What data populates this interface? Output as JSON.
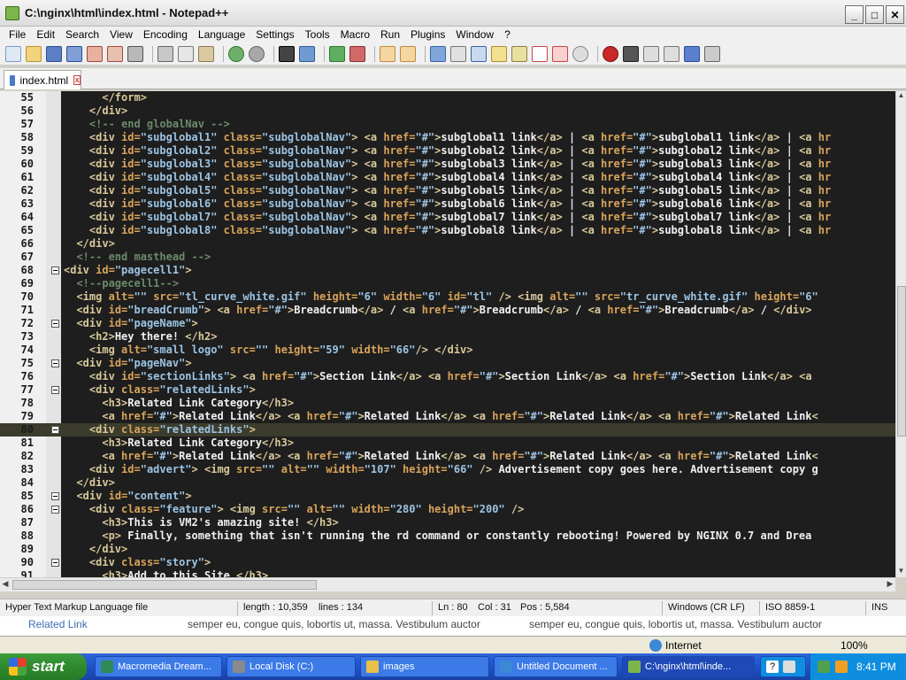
{
  "window": {
    "title": "C:\\nginx\\html\\index.html - Notepad++",
    "min_label": "_",
    "max_label": "□",
    "close_label": "✕"
  },
  "menu": [
    "File",
    "Edit",
    "Search",
    "View",
    "Encoding",
    "Language",
    "Settings",
    "Tools",
    "Macro",
    "Run",
    "Plugins",
    "Window",
    "?"
  ],
  "tab": {
    "label": "index.html"
  },
  "editor": {
    "current_line": 80,
    "lines": [
      {
        "n": "55",
        "fold": false,
        "html": "      <span class=\"tag\">&lt;/form&gt;</span>"
      },
      {
        "n": "56",
        "fold": false,
        "html": "    <span class=\"tag\">&lt;/div&gt;</span>"
      },
      {
        "n": "57",
        "fold": false,
        "html": "    <span class=\"cmt\">&lt;!-- end globalNav --&gt;</span>"
      },
      {
        "n": "58",
        "fold": false,
        "html": "    <span class=\"tag\">&lt;div</span> <span class=\"attr\">id=</span><span class=\"val\">\"subglobal1\"</span> <span class=\"attr\">class=</span><span class=\"val\">\"subglobalNav\"</span><span class=\"tag\">&gt;</span> <span class=\"tag\">&lt;a</span> <span class=\"attr\">href=</span><span class=\"val\">\"#\"</span><span class=\"tag\">&gt;</span><span class=\"txt\">subglobal1 link</span><span class=\"tag\">&lt;/a&gt;</span> | <span class=\"tag\">&lt;a</span> <span class=\"attr\">href=</span><span class=\"val\">\"#\"</span><span class=\"tag\">&gt;</span><span class=\"txt\">subglobal1 link</span><span class=\"tag\">&lt;/a&gt;</span> | <span class=\"tag\">&lt;a</span> <span class=\"attr\">hr</span>"
      },
      {
        "n": "59",
        "fold": false,
        "html": "    <span class=\"tag\">&lt;div</span> <span class=\"attr\">id=</span><span class=\"val\">\"subglobal2\"</span> <span class=\"attr\">class=</span><span class=\"val\">\"subglobalNav\"</span><span class=\"tag\">&gt;</span> <span class=\"tag\">&lt;a</span> <span class=\"attr\">href=</span><span class=\"val\">\"#\"</span><span class=\"tag\">&gt;</span><span class=\"txt\">subglobal2 link</span><span class=\"tag\">&lt;/a&gt;</span> | <span class=\"tag\">&lt;a</span> <span class=\"attr\">href=</span><span class=\"val\">\"#\"</span><span class=\"tag\">&gt;</span><span class=\"txt\">subglobal2 link</span><span class=\"tag\">&lt;/a&gt;</span> | <span class=\"tag\">&lt;a</span> <span class=\"attr\">hr</span>"
      },
      {
        "n": "60",
        "fold": false,
        "html": "    <span class=\"tag\">&lt;div</span> <span class=\"attr\">id=</span><span class=\"val\">\"subglobal3\"</span> <span class=\"attr\">class=</span><span class=\"val\">\"subglobalNav\"</span><span class=\"tag\">&gt;</span> <span class=\"tag\">&lt;a</span> <span class=\"attr\">href=</span><span class=\"val\">\"#\"</span><span class=\"tag\">&gt;</span><span class=\"txt\">subglobal3 link</span><span class=\"tag\">&lt;/a&gt;</span> | <span class=\"tag\">&lt;a</span> <span class=\"attr\">href=</span><span class=\"val\">\"#\"</span><span class=\"tag\">&gt;</span><span class=\"txt\">subglobal3 link</span><span class=\"tag\">&lt;/a&gt;</span> | <span class=\"tag\">&lt;a</span> <span class=\"attr\">hr</span>"
      },
      {
        "n": "61",
        "fold": false,
        "html": "    <span class=\"tag\">&lt;div</span> <span class=\"attr\">id=</span><span class=\"val\">\"subglobal4\"</span> <span class=\"attr\">class=</span><span class=\"val\">\"subglobalNav\"</span><span class=\"tag\">&gt;</span> <span class=\"tag\">&lt;a</span> <span class=\"attr\">href=</span><span class=\"val\">\"#\"</span><span class=\"tag\">&gt;</span><span class=\"txt\">subglobal4 link</span><span class=\"tag\">&lt;/a&gt;</span> | <span class=\"tag\">&lt;a</span> <span class=\"attr\">href=</span><span class=\"val\">\"#\"</span><span class=\"tag\">&gt;</span><span class=\"txt\">subglobal4 link</span><span class=\"tag\">&lt;/a&gt;</span> | <span class=\"tag\">&lt;a</span> <span class=\"attr\">hr</span>"
      },
      {
        "n": "62",
        "fold": false,
        "html": "    <span class=\"tag\">&lt;div</span> <span class=\"attr\">id=</span><span class=\"val\">\"subglobal5\"</span> <span class=\"attr\">class=</span><span class=\"val\">\"subglobalNav\"</span><span class=\"tag\">&gt;</span> <span class=\"tag\">&lt;a</span> <span class=\"attr\">href=</span><span class=\"val\">\"#\"</span><span class=\"tag\">&gt;</span><span class=\"txt\">subglobal5 link</span><span class=\"tag\">&lt;/a&gt;</span> | <span class=\"tag\">&lt;a</span> <span class=\"attr\">href=</span><span class=\"val\">\"#\"</span><span class=\"tag\">&gt;</span><span class=\"txt\">subglobal5 link</span><span class=\"tag\">&lt;/a&gt;</span> | <span class=\"tag\">&lt;a</span> <span class=\"attr\">hr</span>"
      },
      {
        "n": "63",
        "fold": false,
        "html": "    <span class=\"tag\">&lt;div</span> <span class=\"attr\">id=</span><span class=\"val\">\"subglobal6\"</span> <span class=\"attr\">class=</span><span class=\"val\">\"subglobalNav\"</span><span class=\"tag\">&gt;</span> <span class=\"tag\">&lt;a</span> <span class=\"attr\">href=</span><span class=\"val\">\"#\"</span><span class=\"tag\">&gt;</span><span class=\"txt\">subglobal6 link</span><span class=\"tag\">&lt;/a&gt;</span> | <span class=\"tag\">&lt;a</span> <span class=\"attr\">href=</span><span class=\"val\">\"#\"</span><span class=\"tag\">&gt;</span><span class=\"txt\">subglobal6 link</span><span class=\"tag\">&lt;/a&gt;</span> | <span class=\"tag\">&lt;a</span> <span class=\"attr\">hr</span>"
      },
      {
        "n": "64",
        "fold": false,
        "html": "    <span class=\"tag\">&lt;div</span> <span class=\"attr\">id=</span><span class=\"val\">\"subglobal7\"</span> <span class=\"attr\">class=</span><span class=\"val\">\"subglobalNav\"</span><span class=\"tag\">&gt;</span> <span class=\"tag\">&lt;a</span> <span class=\"attr\">href=</span><span class=\"val\">\"#\"</span><span class=\"tag\">&gt;</span><span class=\"txt\">subglobal7 link</span><span class=\"tag\">&lt;/a&gt;</span> | <span class=\"tag\">&lt;a</span> <span class=\"attr\">href=</span><span class=\"val\">\"#\"</span><span class=\"tag\">&gt;</span><span class=\"txt\">subglobal7 link</span><span class=\"tag\">&lt;/a&gt;</span> | <span class=\"tag\">&lt;a</span> <span class=\"attr\">hr</span>"
      },
      {
        "n": "65",
        "fold": false,
        "html": "    <span class=\"tag\">&lt;div</span> <span class=\"attr\">id=</span><span class=\"val\">\"subglobal8\"</span> <span class=\"attr\">class=</span><span class=\"val\">\"subglobalNav\"</span><span class=\"tag\">&gt;</span> <span class=\"tag\">&lt;a</span> <span class=\"attr\">href=</span><span class=\"val\">\"#\"</span><span class=\"tag\">&gt;</span><span class=\"txt\">subglobal8 link</span><span class=\"tag\">&lt;/a&gt;</span> | <span class=\"tag\">&lt;a</span> <span class=\"attr\">href=</span><span class=\"val\">\"#\"</span><span class=\"tag\">&gt;</span><span class=\"txt\">subglobal8 link</span><span class=\"tag\">&lt;/a&gt;</span> | <span class=\"tag\">&lt;a</span> <span class=\"attr\">hr</span>"
      },
      {
        "n": "66",
        "fold": false,
        "html": "  <span class=\"tag\">&lt;/div&gt;</span>"
      },
      {
        "n": "67",
        "fold": false,
        "html": "  <span class=\"cmt\">&lt;!-- end masthead --&gt;</span>"
      },
      {
        "n": "68",
        "fold": true,
        "html": "<span class=\"tag\">&lt;div</span> <span class=\"attr\">id=</span><span class=\"val\">\"pagecell1\"</span><span class=\"tag\">&gt;</span>"
      },
      {
        "n": "69",
        "fold": false,
        "html": "  <span class=\"cmt\">&lt;!--pagecell1--&gt;</span>"
      },
      {
        "n": "70",
        "fold": false,
        "html": "  <span class=\"tag\">&lt;img</span> <span class=\"attr\">alt=</span><span class=\"val\">\"\"</span> <span class=\"attr\">src=</span><span class=\"val\">\"tl_curve_white.gif\"</span> <span class=\"attr\">height=</span><span class=\"val\">\"6\"</span> <span class=\"attr\">width=</span><span class=\"val\">\"6\"</span> <span class=\"attr\">id=</span><span class=\"val\">\"tl\"</span> <span class=\"tag\">/&gt;</span> <span class=\"tag\">&lt;img</span> <span class=\"attr\">alt=</span><span class=\"val\">\"\"</span> <span class=\"attr\">src=</span><span class=\"val\">\"tr_curve_white.gif\"</span> <span class=\"attr\">height=</span><span class=\"val\">\"6\"</span>"
      },
      {
        "n": "71",
        "fold": false,
        "html": "  <span class=\"tag\">&lt;div</span> <span class=\"attr\">id=</span><span class=\"val\">\"breadCrumb\"</span><span class=\"tag\">&gt;</span> <span class=\"tag\">&lt;a</span> <span class=\"attr\">href=</span><span class=\"val\">\"#\"</span><span class=\"tag\">&gt;</span><span class=\"txt\">Breadcrumb</span><span class=\"tag\">&lt;/a&gt;</span> / <span class=\"tag\">&lt;a</span> <span class=\"attr\">href=</span><span class=\"val\">\"#\"</span><span class=\"tag\">&gt;</span><span class=\"txt\">Breadcrumb</span><span class=\"tag\">&lt;/a&gt;</span> / <span class=\"tag\">&lt;a</span> <span class=\"attr\">href=</span><span class=\"val\">\"#\"</span><span class=\"tag\">&gt;</span><span class=\"txt\">Breadcrumb</span><span class=\"tag\">&lt;/a&gt;</span> / <span class=\"tag\">&lt;/div&gt;</span>"
      },
      {
        "n": "72",
        "fold": true,
        "html": "  <span class=\"tag\">&lt;div</span> <span class=\"attr\">id=</span><span class=\"val\">\"pageName\"</span><span class=\"tag\">&gt;</span>"
      },
      {
        "n": "73",
        "fold": false,
        "html": "    <span class=\"tag\">&lt;h2&gt;</span><span class=\"txt\">Hey there! </span><span class=\"tag\">&lt;/h2&gt;</span>"
      },
      {
        "n": "74",
        "fold": false,
        "html": "    <span class=\"tag\">&lt;img</span> <span class=\"attr\">alt=</span><span class=\"val\">\"small logo\"</span> <span class=\"attr\">src=</span><span class=\"val\">\"\"</span> <span class=\"attr\">height=</span><span class=\"val\">\"59\"</span> <span class=\"attr\">width=</span><span class=\"val\">\"66\"</span><span class=\"tag\">/&gt;</span> <span class=\"tag\">&lt;/div&gt;</span>"
      },
      {
        "n": "75",
        "fold": true,
        "html": "  <span class=\"tag\">&lt;div</span> <span class=\"attr\">id=</span><span class=\"val\">\"pageNav\"</span><span class=\"tag\">&gt;</span>"
      },
      {
        "n": "76",
        "fold": false,
        "html": "    <span class=\"tag\">&lt;div</span> <span class=\"attr\">id=</span><span class=\"val\">\"sectionLinks\"</span><span class=\"tag\">&gt;</span> <span class=\"tag\">&lt;a</span> <span class=\"attr\">href=</span><span class=\"val\">\"#\"</span><span class=\"tag\">&gt;</span><span class=\"txt\">Section Link</span><span class=\"tag\">&lt;/a&gt;</span> <span class=\"tag\">&lt;a</span> <span class=\"attr\">href=</span><span class=\"val\">\"#\"</span><span class=\"tag\">&gt;</span><span class=\"txt\">Section Link</span><span class=\"tag\">&lt;/a&gt;</span> <span class=\"tag\">&lt;a</span> <span class=\"attr\">href=</span><span class=\"val\">\"#\"</span><span class=\"tag\">&gt;</span><span class=\"txt\">Section Link</span><span class=\"tag\">&lt;/a&gt;</span> <span class=\"tag\">&lt;a</span>"
      },
      {
        "n": "77",
        "fold": true,
        "html": "    <span class=\"tag\">&lt;div</span> <span class=\"attr\">class=</span><span class=\"val\">\"relatedLinks\"</span><span class=\"tag\">&gt;</span>"
      },
      {
        "n": "78",
        "fold": false,
        "html": "      <span class=\"tag\">&lt;h3&gt;</span><span class=\"txt\">Related Link Category</span><span class=\"tag\">&lt;/h3&gt;</span>"
      },
      {
        "n": "79",
        "fold": false,
        "html": "      <span class=\"tag\">&lt;a</span> <span class=\"attr\">href=</span><span class=\"val\">\"#\"</span><span class=\"tag\">&gt;</span><span class=\"txt\">Related Link</span><span class=\"tag\">&lt;/a&gt;</span> <span class=\"tag\">&lt;a</span> <span class=\"attr\">href=</span><span class=\"val\">\"#\"</span><span class=\"tag\">&gt;</span><span class=\"txt\">Related Link</span><span class=\"tag\">&lt;/a&gt;</span> <span class=\"tag\">&lt;a</span> <span class=\"attr\">href=</span><span class=\"val\">\"#\"</span><span class=\"tag\">&gt;</span><span class=\"txt\">Related Link</span><span class=\"tag\">&lt;/a&gt;</span> <span class=\"tag\">&lt;a</span> <span class=\"attr\">href=</span><span class=\"val\">\"#\"</span><span class=\"tag\">&gt;</span><span class=\"txt\">Related Link</span><span class=\"tag\">&lt;</span>"
      },
      {
        "n": "80",
        "fold": true,
        "html": "    <span class=\"tag\">&lt;div</span> <span class=\"attr\">class=</span><span class=\"val\">\"relatedLinks\"</span><span class=\"tag\">&gt;</span>"
      },
      {
        "n": "81",
        "fold": false,
        "html": "      <span class=\"tag\">&lt;h3&gt;</span><span class=\"txt\">Related Link Category</span><span class=\"tag\">&lt;/h3&gt;</span>"
      },
      {
        "n": "82",
        "fold": false,
        "html": "      <span class=\"tag\">&lt;a</span> <span class=\"attr\">href=</span><span class=\"val\">\"#\"</span><span class=\"tag\">&gt;</span><span class=\"txt\">Related Link</span><span class=\"tag\">&lt;/a&gt;</span> <span class=\"tag\">&lt;a</span> <span class=\"attr\">href=</span><span class=\"val\">\"#\"</span><span class=\"tag\">&gt;</span><span class=\"txt\">Related Link</span><span class=\"tag\">&lt;/a&gt;</span> <span class=\"tag\">&lt;a</span> <span class=\"attr\">href=</span><span class=\"val\">\"#\"</span><span class=\"tag\">&gt;</span><span class=\"txt\">Related Link</span><span class=\"tag\">&lt;/a&gt;</span> <span class=\"tag\">&lt;a</span> <span class=\"attr\">href=</span><span class=\"val\">\"#\"</span><span class=\"tag\">&gt;</span><span class=\"txt\">Related Link</span><span class=\"tag\">&lt;</span>"
      },
      {
        "n": "83",
        "fold": false,
        "html": "    <span class=\"tag\">&lt;div</span> <span class=\"attr\">id=</span><span class=\"val\">\"advert\"</span><span class=\"tag\">&gt;</span> <span class=\"tag\">&lt;img</span> <span class=\"attr\">src=</span><span class=\"val\">\"\"</span> <span class=\"attr\">alt=</span><span class=\"val\">\"\"</span> <span class=\"attr\">width=</span><span class=\"val\">\"107\"</span> <span class=\"attr\">height=</span><span class=\"val\">\"66\"</span> <span class=\"tag\">/&gt;</span> <span class=\"txt\">Advertisement copy goes here. Advertisement copy g</span>"
      },
      {
        "n": "84",
        "fold": false,
        "html": "  <span class=\"tag\">&lt;/div&gt;</span>"
      },
      {
        "n": "85",
        "fold": true,
        "html": "  <span class=\"tag\">&lt;div</span> <span class=\"attr\">id=</span><span class=\"val\">\"content\"</span><span class=\"tag\">&gt;</span>"
      },
      {
        "n": "86",
        "fold": true,
        "html": "    <span class=\"tag\">&lt;div</span> <span class=\"attr\">class=</span><span class=\"val\">\"feature\"</span><span class=\"tag\">&gt;</span> <span class=\"tag\">&lt;img</span> <span class=\"attr\">src=</span><span class=\"val\">\"\"</span> <span class=\"attr\">alt=</span><span class=\"val\">\"\"</span> <span class=\"attr\">width=</span><span class=\"val\">\"280\"</span> <span class=\"attr\">height=</span><span class=\"val\">\"200\"</span> <span class=\"tag\">/&gt;</span>"
      },
      {
        "n": "87",
        "fold": false,
        "html": "      <span class=\"tag\">&lt;h3&gt;</span><span class=\"txt\">This is VM2's amazing site! </span><span class=\"tag\">&lt;/h3&gt;</span>"
      },
      {
        "n": "88",
        "fold": false,
        "html": "      <span class=\"tag\">&lt;p&gt;</span><span class=\"txt\"> Finally, something that isn't running the rd command or constantly rebooting! Powered by NGINX 0.7 and Drea</span>"
      },
      {
        "n": "89",
        "fold": false,
        "html": "    <span class=\"tag\">&lt;/div&gt;</span>"
      },
      {
        "n": "90",
        "fold": true,
        "html": "    <span class=\"tag\">&lt;div</span> <span class=\"attr\">class=</span><span class=\"val\">\"story\"</span><span class=\"tag\">&gt;</span>"
      },
      {
        "n": "91",
        "fold": false,
        "html": "      <span class=\"tag\">&lt;h3&gt;</span><span class=\"txt\">Add to this Site </span><span class=\"tag\">&lt;/h3&gt;</span>"
      }
    ]
  },
  "status": {
    "filetype": "Hyper Text Markup Language file",
    "length": "length : 10,359",
    "lines": "lines : 134",
    "ln": "Ln : 80",
    "col": "Col : 31",
    "pos": "Pos : 5,584",
    "eol": "Windows (CR LF)",
    "encoding": "ISO 8859-1",
    "mode": "INS"
  },
  "behind": {
    "left_link": "Related Link",
    "text1": "semper eu, congue quis, lobortis ut, massa. Vestibulum auctor",
    "text2": "semper eu, congue quis, lobortis ut, massa. Vestibulum auctor"
  },
  "iebar": {
    "zone": "Internet",
    "zoom": "100%"
  },
  "taskbar": {
    "start": "start",
    "tasks": [
      {
        "label": "Macromedia Dream...",
        "color": "#2e8b57"
      },
      {
        "label": "Local Disk (C:)",
        "color": "#8a8a8a"
      },
      {
        "label": "images",
        "color": "#e8c04a"
      },
      {
        "label": "Untitled Document ...",
        "color": "#3b88d6"
      },
      {
        "label": "C:\\nginx\\html\\inde...",
        "color": "#7bb64a"
      }
    ],
    "clock": "8:41 PM"
  }
}
